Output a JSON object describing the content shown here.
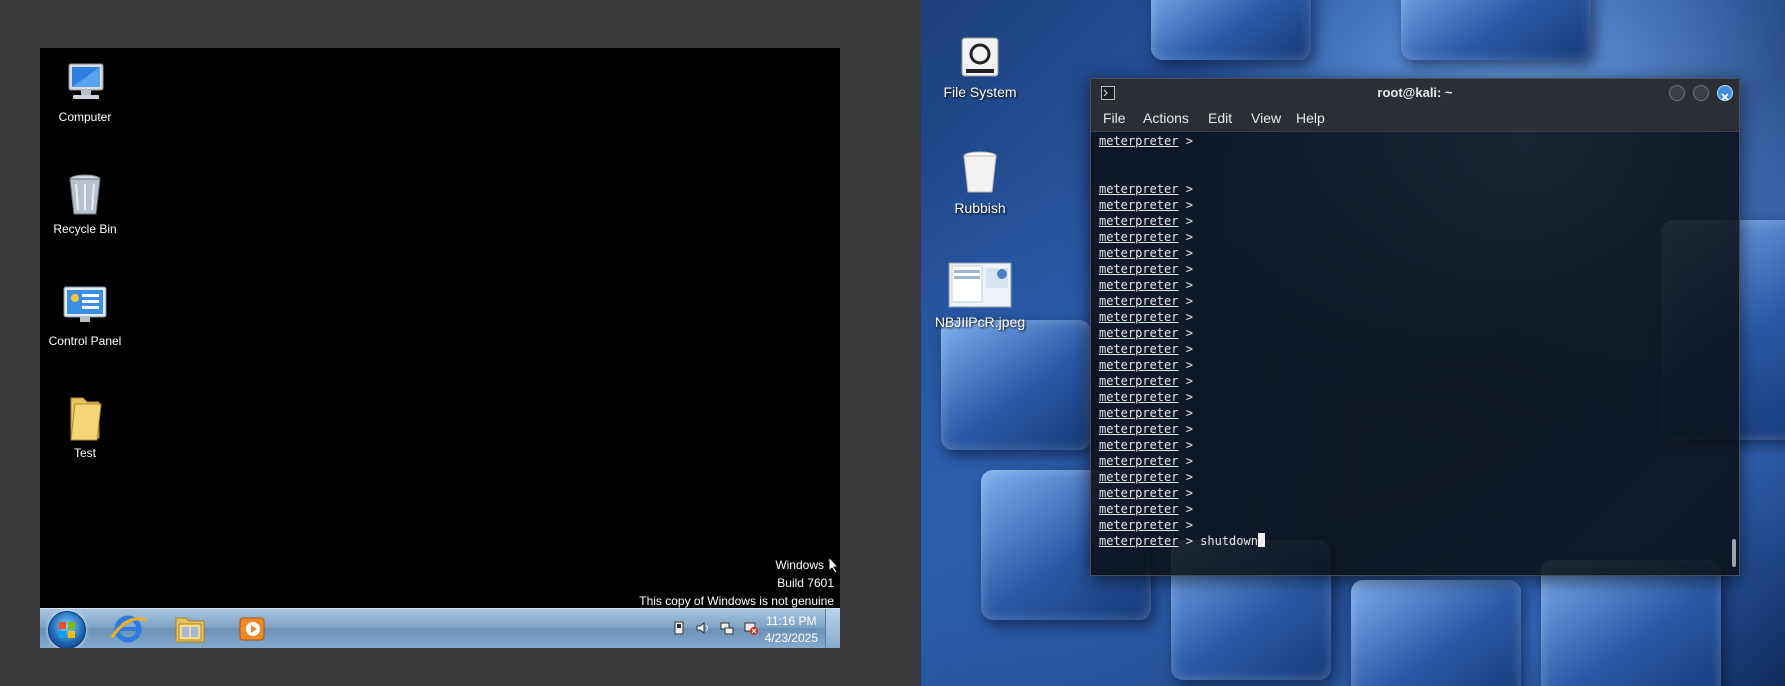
{
  "windows_vm": {
    "desktop_icons": [
      {
        "label": "Computer",
        "icon": "computer-icon"
      },
      {
        "label": "Recycle Bin",
        "icon": "recycle-bin-icon"
      },
      {
        "label": "Control Panel",
        "icon": "control-panel-icon"
      },
      {
        "label": "Test",
        "icon": "folder-icon"
      }
    ],
    "watermark": {
      "line1": "Windows 7",
      "line2": "Build 7601",
      "line3": "This copy of Windows is not genuine"
    },
    "taskbar": {
      "pinned": [
        "internet-explorer-icon",
        "windows-explorer-icon",
        "media-player-icon"
      ],
      "clock_time": "11:16 PM",
      "clock_date": "4/23/2025"
    }
  },
  "kali": {
    "desktop_icons": [
      {
        "label": "File System",
        "icon": "file-system-icon"
      },
      {
        "label": "Rubbish",
        "icon": "trash-icon"
      },
      {
        "label": "NBJIlPcR.jpeg",
        "icon": "image-file-icon"
      }
    ],
    "terminal": {
      "title": "root@kali: ~",
      "menu": [
        "File",
        "Actions",
        "Edit",
        "View",
        "Help"
      ],
      "prompt": "meterpreter",
      "prompt_suffix": " >",
      "current_command": " > shutdown"
    }
  }
}
